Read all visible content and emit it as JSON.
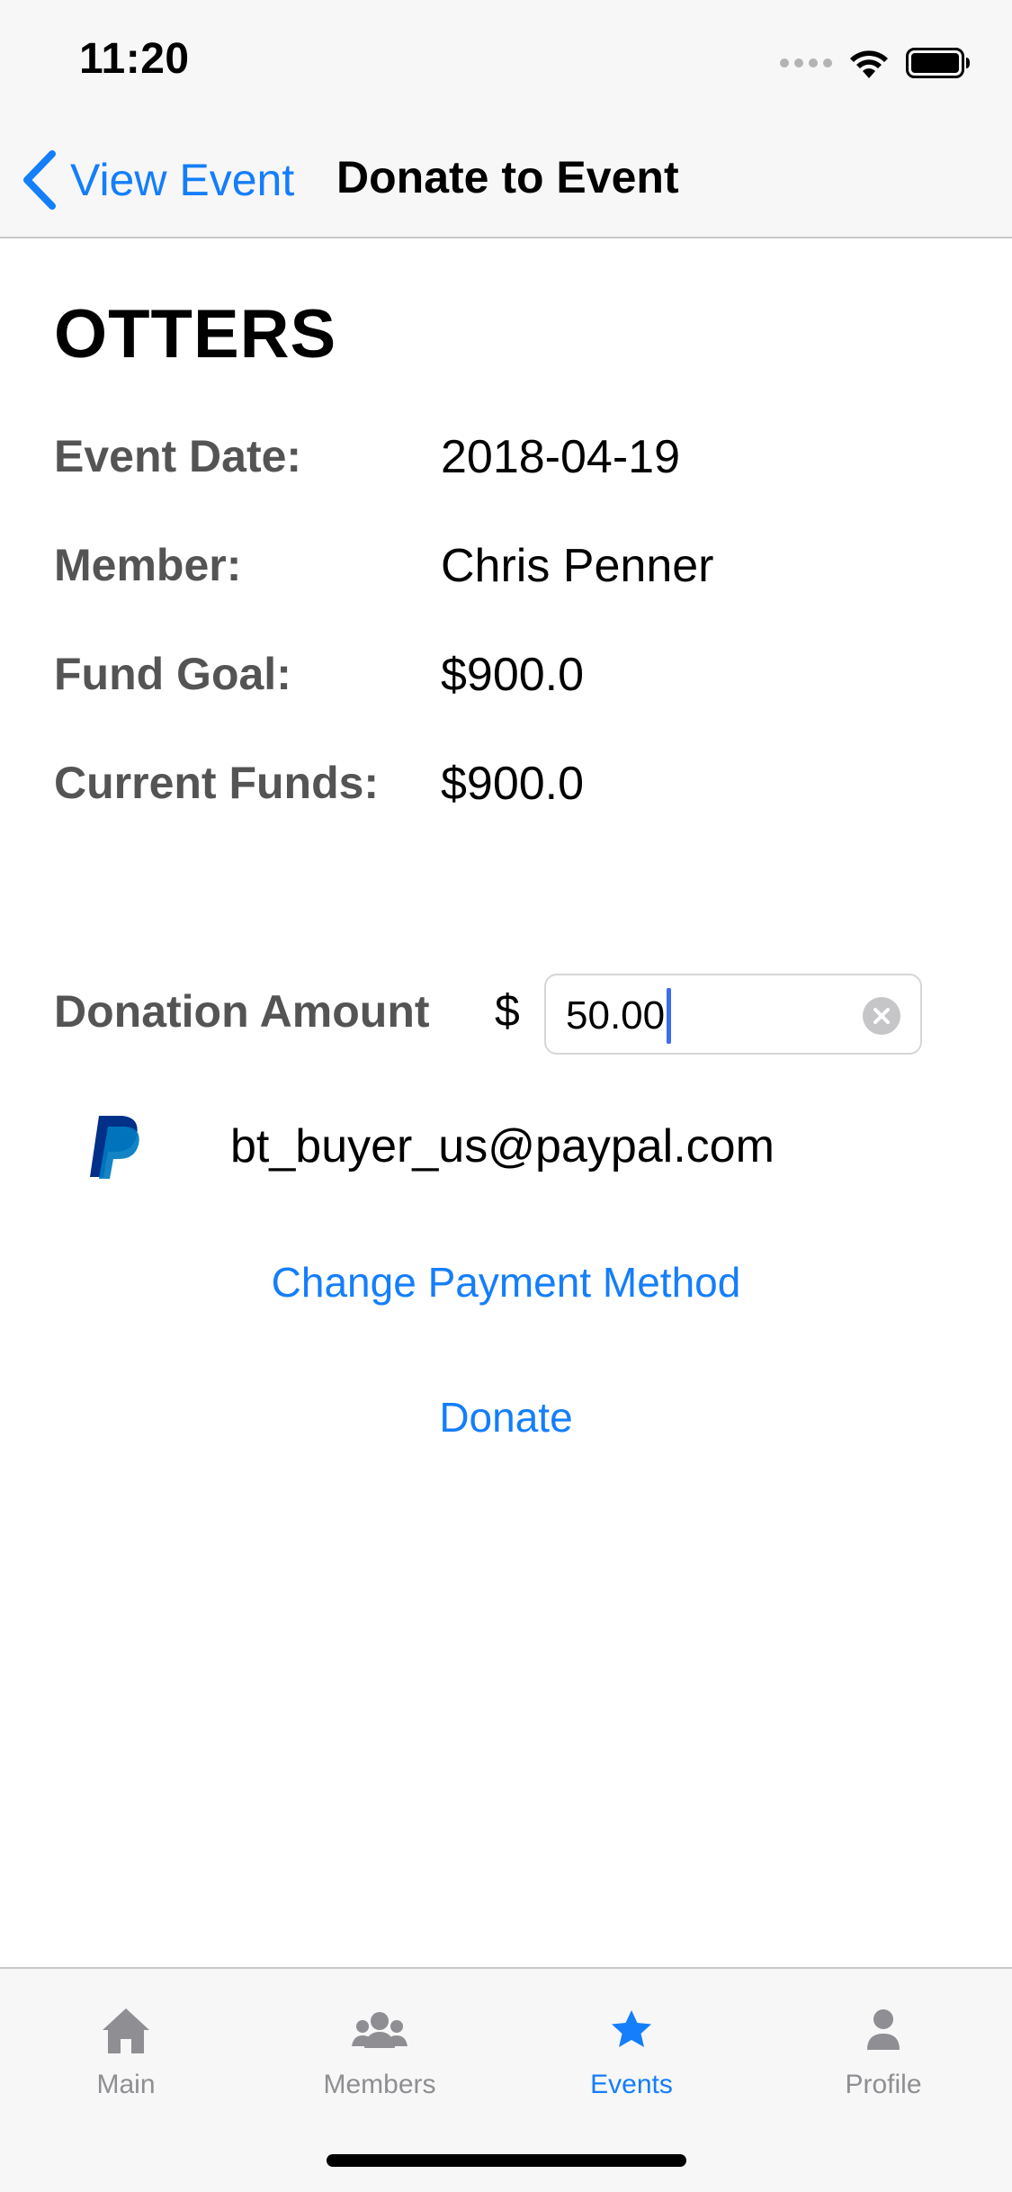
{
  "status_bar": {
    "time": "11:20"
  },
  "nav": {
    "back_label": "View Event",
    "title": "Donate to Event"
  },
  "event": {
    "name": "OTTERS",
    "rows": [
      {
        "label": "Event Date:",
        "value": "2018-04-19"
      },
      {
        "label": "Member:",
        "value": "Chris Penner"
      },
      {
        "label": "Fund Goal:",
        "value": "$900.0"
      },
      {
        "label": "Current Funds:",
        "value": "$900.0"
      }
    ]
  },
  "donation": {
    "label": "Donation Amount",
    "currency_symbol": "$",
    "amount": "50.00"
  },
  "payment": {
    "method_icon": "paypal-icon",
    "email": "bt_buyer_us@paypal.com"
  },
  "actions": {
    "change_payment": "Change Payment Method",
    "donate": "Donate"
  },
  "tab_bar": {
    "items": [
      {
        "label": "Main",
        "icon": "home-icon"
      },
      {
        "label": "Members",
        "icon": "people-icon"
      },
      {
        "label": "Events",
        "icon": "star-icon",
        "active": true
      },
      {
        "label": "Profile",
        "icon": "person-icon"
      }
    ]
  },
  "colors": {
    "accent": "#147efb",
    "label_gray": "#545454",
    "inactive_tab": "#8e8e93"
  }
}
